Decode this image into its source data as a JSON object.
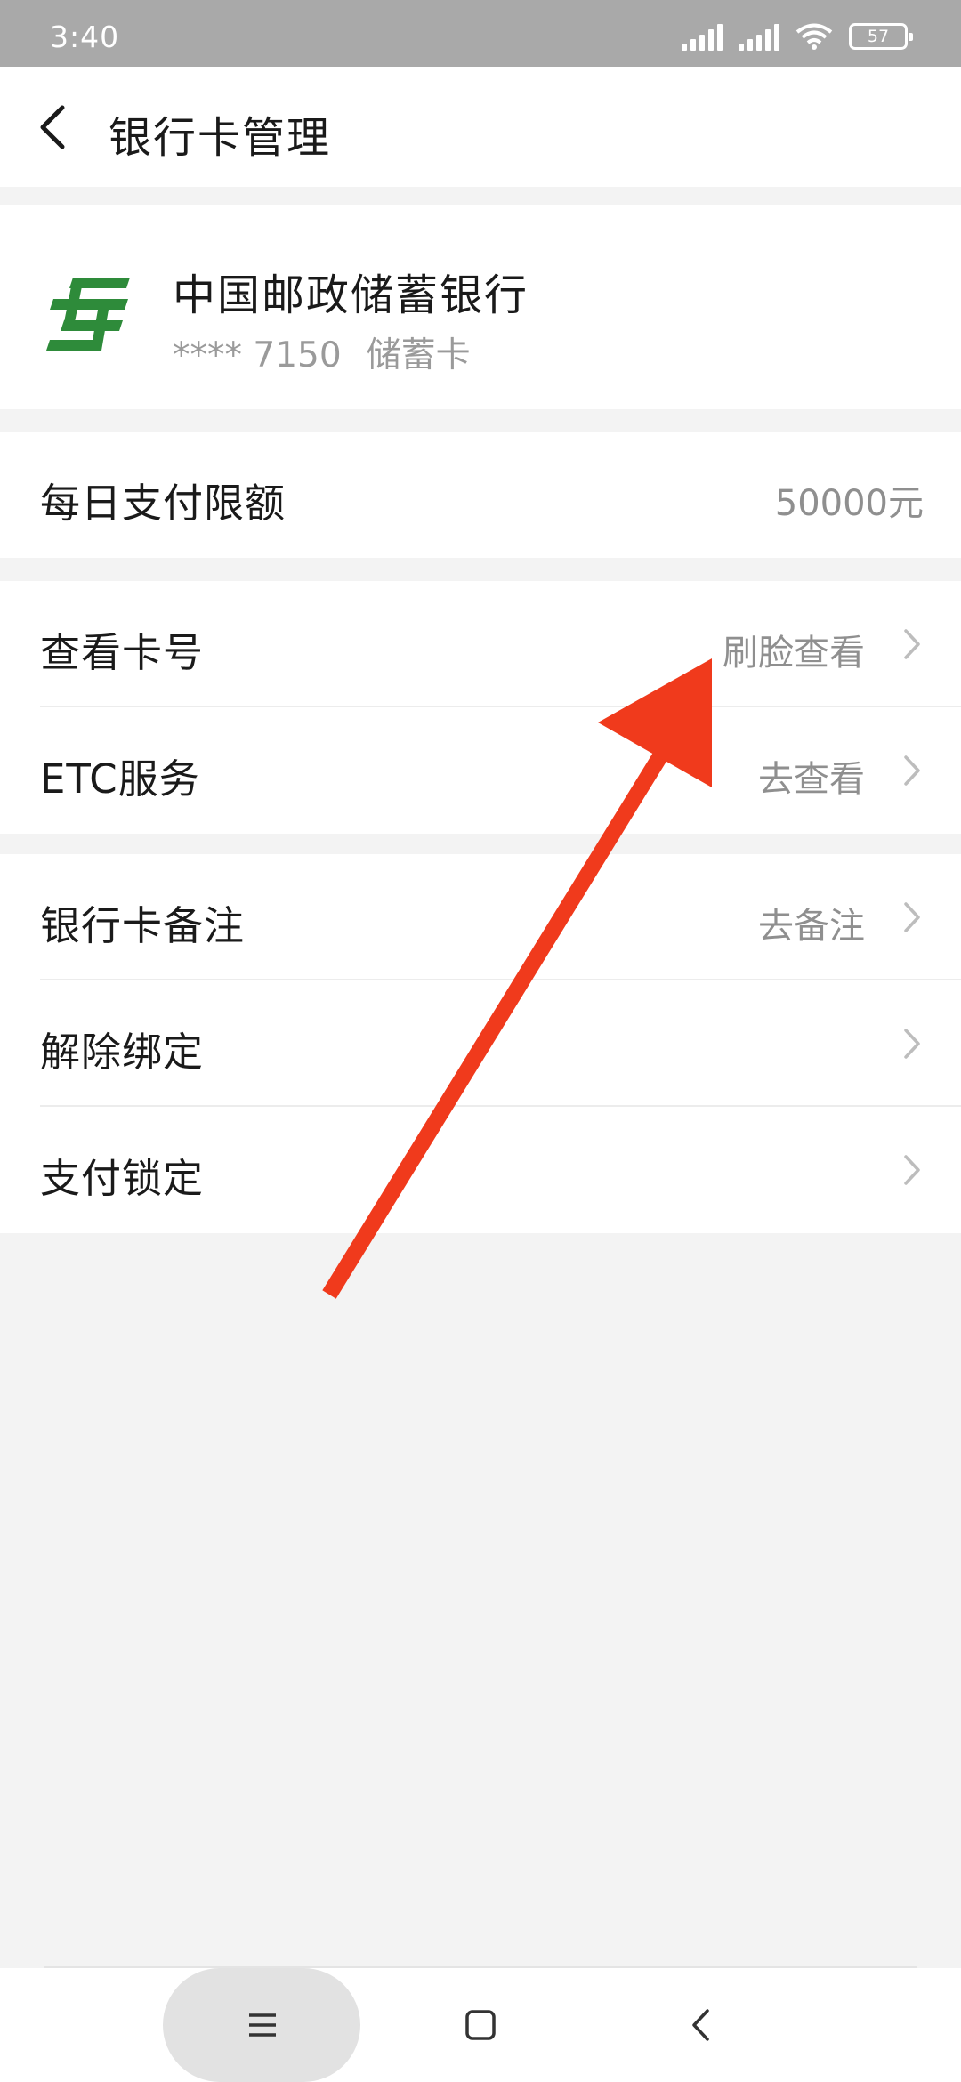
{
  "status_bar": {
    "time": "3:40",
    "battery": "57"
  },
  "header": {
    "title": "银行卡管理"
  },
  "card": {
    "bank_name": "中国邮政储蓄银行",
    "masked_number": "**** 7150",
    "card_type": "储蓄卡",
    "logo_color": "#2e8b3a"
  },
  "limit_row": {
    "label": "每日支付限额",
    "value": "50000元"
  },
  "group_two": [
    {
      "label": "查看卡号",
      "value": "刷脸查看"
    },
    {
      "label": "ETC服务",
      "value": "去查看"
    }
  ],
  "group_three": [
    {
      "label": "银行卡备注",
      "value": "去备注"
    },
    {
      "label": "解除绑定",
      "value": ""
    },
    {
      "label": "支付锁定",
      "value": ""
    }
  ],
  "annotation": {
    "arrow_color": "#f03a1c"
  }
}
